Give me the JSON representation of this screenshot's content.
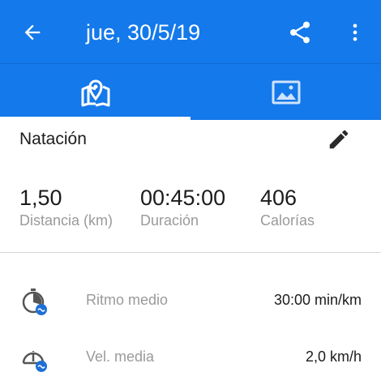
{
  "header": {
    "title": "jue, 30/5/19",
    "back_icon": "arrow-left-icon",
    "share_icon": "share-icon",
    "more_icon": "more-vertical-icon"
  },
  "tabs": [
    {
      "icon": "map-icon",
      "selected": true
    },
    {
      "icon": "photo-icon",
      "selected": false
    }
  ],
  "activity": {
    "sport": "Natación",
    "edit_icon": "pencil-icon"
  },
  "stats": [
    {
      "value": "1,50",
      "label": "Distancia (km)"
    },
    {
      "value": "00:45:00",
      "label": "Duración"
    },
    {
      "value": "406",
      "label": "Calorías"
    }
  ],
  "details": [
    {
      "icon": "stopwatch-icon",
      "name": "Ritmo medio",
      "value": "30:00 min/km"
    },
    {
      "icon": "speedometer-icon",
      "name": "Vel. media",
      "value": "2,0 km/h"
    }
  ],
  "colors": {
    "primary": "#1479ea",
    "accent_badge": "#1e6fd6",
    "text": "#1c1c1c",
    "secondary_text": "#9a9a9a"
  }
}
